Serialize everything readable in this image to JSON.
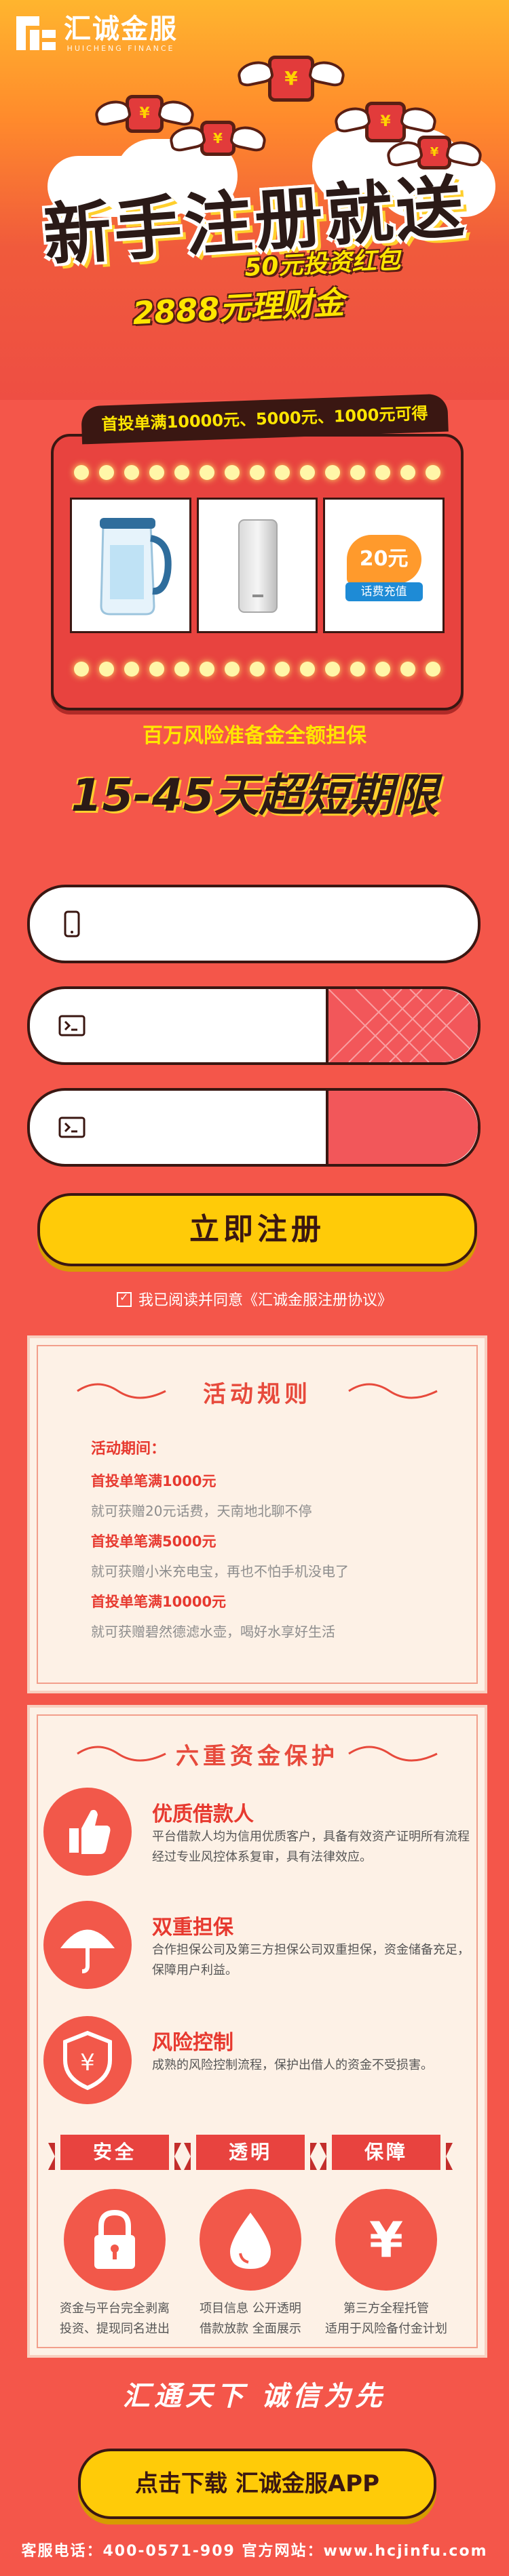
{
  "brand": {
    "name_cn": "汇诚金服",
    "name_en": "HUICHENG FINANCE"
  },
  "hero": {
    "headline": "新手注册就送",
    "offer_1": "50元投资红包",
    "offer_2": "2888元理财金",
    "gift_symbol": "¥"
  },
  "prize": {
    "tag": "首投单满10000元、5000元、1000元可得",
    "items": [
      {
        "name": "water-pitcher"
      },
      {
        "name": "power-bank"
      },
      {
        "amount": "20元",
        "label": "话费充值"
      }
    ]
  },
  "guarantee_text": "百万风险准备金全额担保",
  "term_text": "15-45天超短期限",
  "form": {
    "phone_placeholder": "",
    "password_placeholder": "",
    "code_placeholder": "",
    "submit_label": "立即注册",
    "agreement": "我已阅读并同意《汇诚金服注册协议》"
  },
  "rules": {
    "title": "活动规则",
    "period_label": "活动期间：",
    "items": [
      {
        "condition": "首投单笔满1000元",
        "reward": "就可获赠20元话费，天南地北聊不停"
      },
      {
        "condition": "首投单笔满5000元",
        "reward": "就可获赠小米充电宝，再也不怕手机没电了"
      },
      {
        "condition": "首投单笔满10000元",
        "reward": "就可获赠碧然德滤水壶，喝好水享好生活"
      }
    ]
  },
  "protection": {
    "title": "六重资金保护",
    "features": [
      {
        "title": "优质借款人",
        "desc": "平台借款人均为信用优质客户，具备有效资产证明所有流程经过专业风控体系复审，具有法律效应。"
      },
      {
        "title": "双重担保",
        "desc": "合作担保公司及第三方担保公司双重担保，资金储备充足，保障用户利益。"
      },
      {
        "title": "风险控制",
        "desc": "成熟的风险控制流程，保护出借人的资金不受损害。"
      }
    ],
    "banners": [
      "安全",
      "透明",
      "保障"
    ],
    "bottom": [
      {
        "line1": "资金与平台完全剥离",
        "line2": "投资、提现同名进出"
      },
      {
        "line1": "项目信息  公开透明",
        "line2": "借款放款  全面展示"
      },
      {
        "line1": "第三方全程托管",
        "line2": "适用于风险备付金计划"
      }
    ]
  },
  "slogan": "汇通天下  诚信为先",
  "download_label": "点击下载 汇诚金服APP",
  "footer": "客服电话：400-0571-909    官方网站：www.hcjinfu.com"
}
